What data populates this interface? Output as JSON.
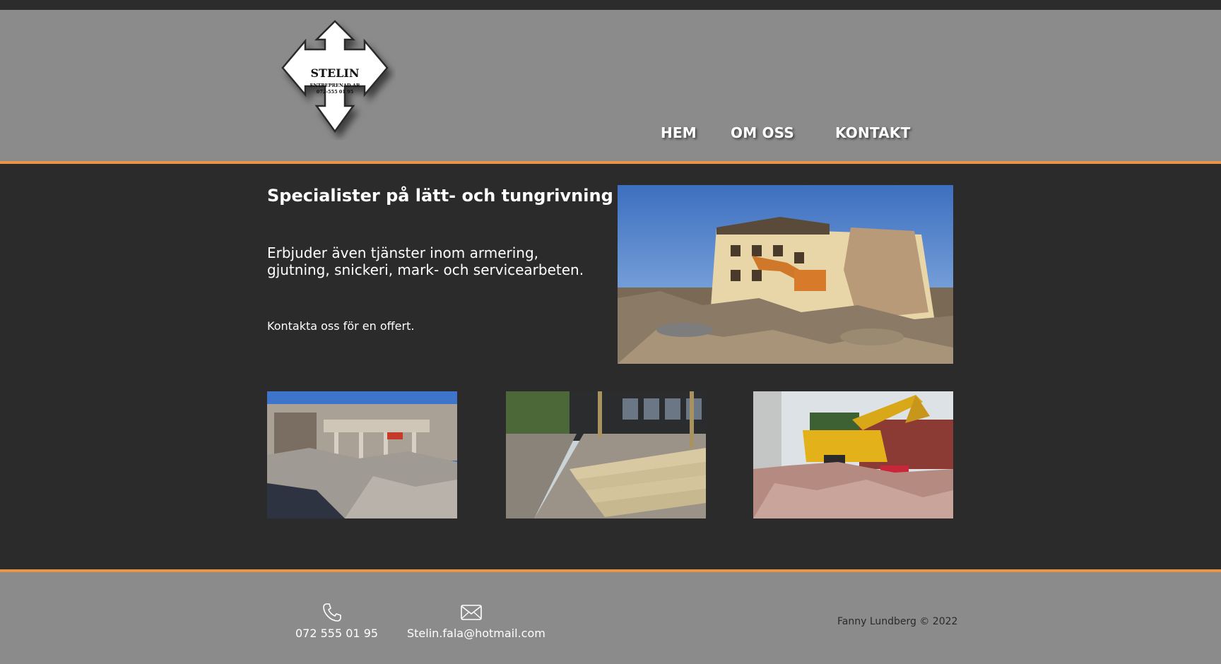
{
  "logo": {
    "name": "STELIN",
    "subtitle": "ENTREPRENAD AB",
    "phone": "072-555 01 95"
  },
  "nav": {
    "home": "HEM",
    "about": "OM OSS",
    "contact": "KONTAKT"
  },
  "hero": {
    "headline": "Specialister på lätt- och tungrivning",
    "services": "Erbjuder även tjänster inom armering, gjutning, snickeri, mark- och servicearbeten.",
    "cta": "Kontakta oss för en offert."
  },
  "footer": {
    "phone": "072 555 01 95",
    "email": "Stelin.fala@hotmail.com",
    "credit": "Fanny Lundberg © 2022",
    "phone_icon": "phone-icon",
    "email_icon": "envelope-icon"
  },
  "colors": {
    "header_bg": "#8b8b8b",
    "main_bg": "#2b2b2b",
    "accent": "#e8954a",
    "text": "#ffffff"
  }
}
